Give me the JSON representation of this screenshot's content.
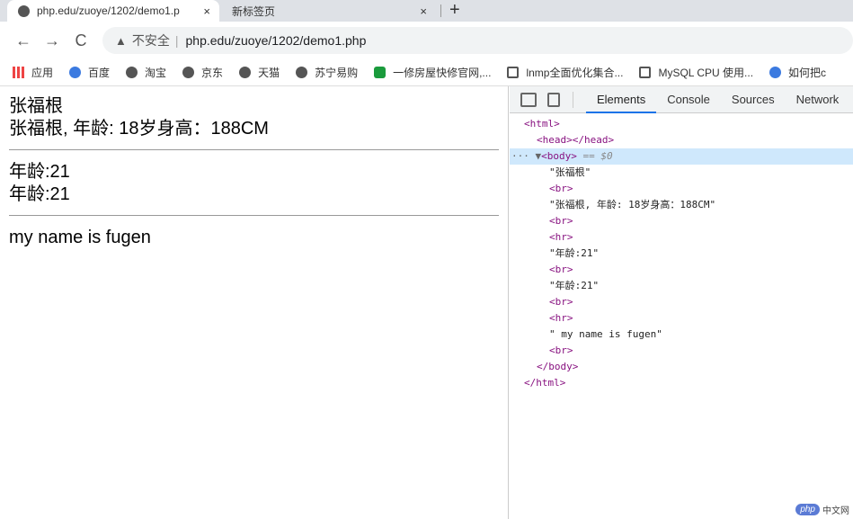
{
  "tabs": [
    {
      "title": "php.edu/zuoye/1202/demo1.p",
      "active": true
    },
    {
      "title": "新标签页",
      "active": false
    }
  ],
  "icons": {
    "close": "×",
    "new_tab": "+",
    "back": "←",
    "forward": "→",
    "reload": "C",
    "warning": "▲"
  },
  "address": {
    "security": "不安全",
    "url": "php.edu/zuoye/1202/demo1.php"
  },
  "bookmarks": [
    "应用",
    "百度",
    "淘宝",
    "京东",
    "天猫",
    "苏宁易购",
    "一修房屋快修官网,...",
    "lnmp全面优化集合...",
    "MySQL CPU 使用...",
    "如何把c"
  ],
  "page": {
    "line1": "张福根",
    "line2": "张福根, 年龄: 18岁身高：188CM",
    "line3": "年龄:21",
    "line4": "年龄:21",
    "line5": "my name is fugen"
  },
  "devtools": {
    "tabs": [
      "Elements",
      "Console",
      "Sources",
      "Network"
    ],
    "tree": [
      "<html>",
      "<head></head>",
      "<body>",
      "== $0",
      "\"张福根\"",
      "<br>",
      "\"张福根, 年龄: 18岁身高：188CM\"",
      "<br>",
      "<hr>",
      "\"年龄:21\"",
      "<br>",
      "\"年龄:21\"",
      "<br>",
      "<hr>",
      "\" my name is fugen\"",
      "<br>",
      "</body>",
      "</html>"
    ]
  },
  "watermark": {
    "logo": "php",
    "text": "中文网"
  }
}
